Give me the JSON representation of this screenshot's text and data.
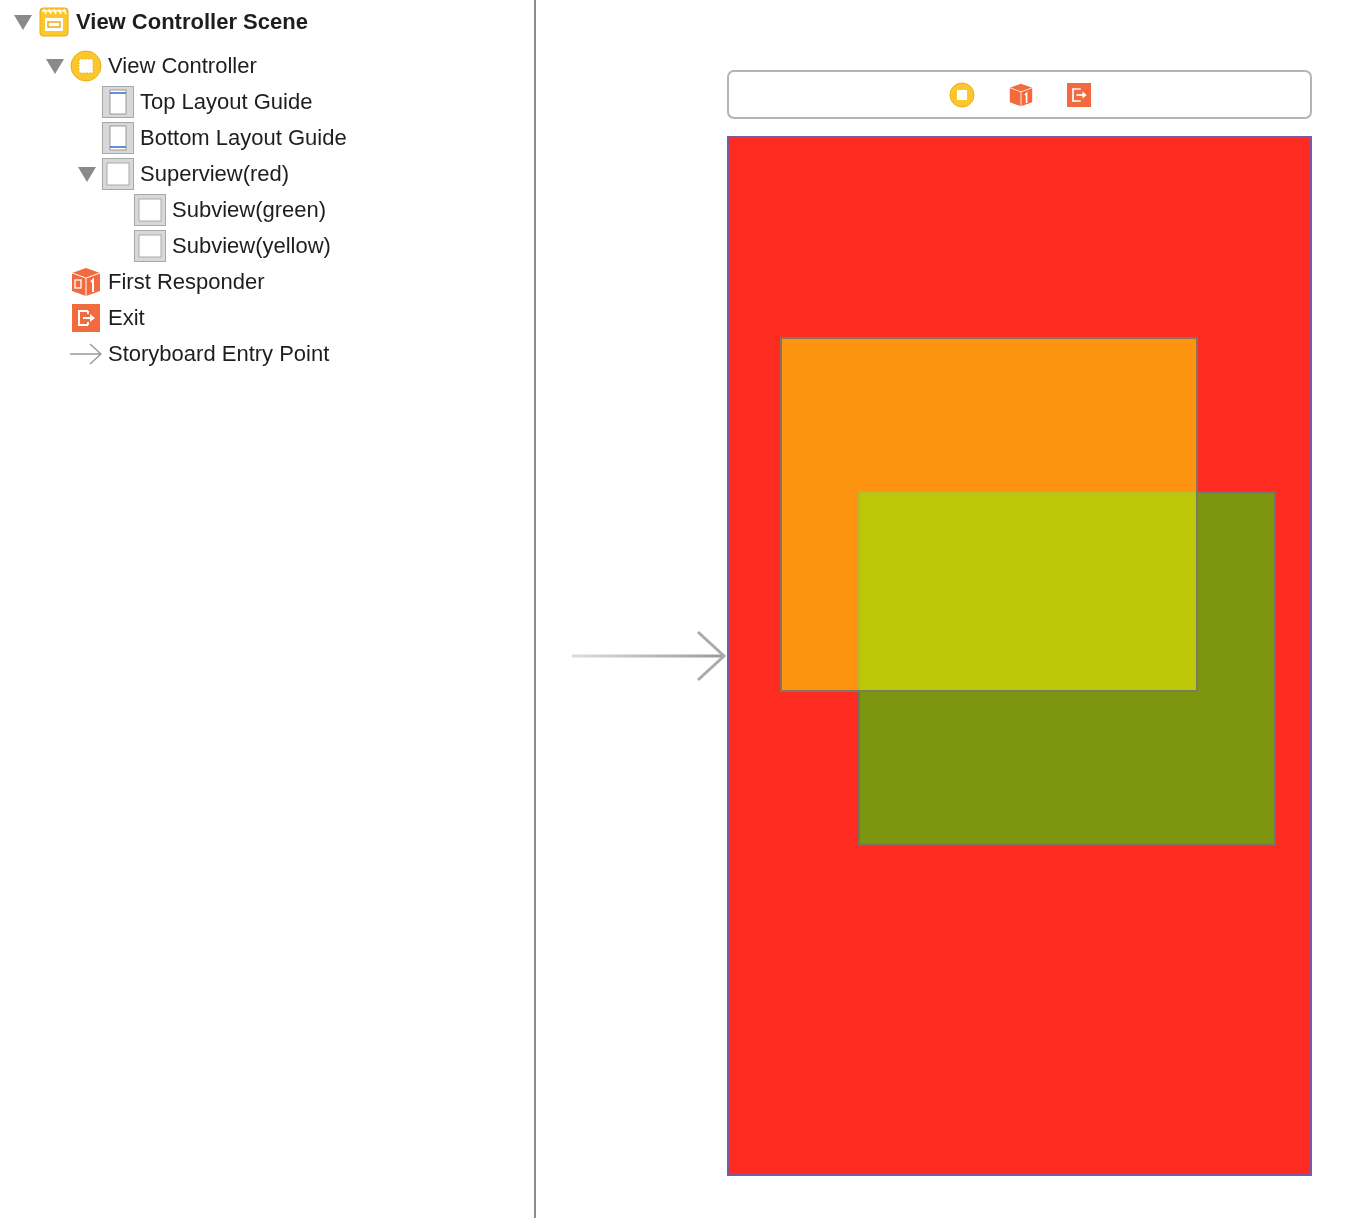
{
  "outline": {
    "items": [
      {
        "kind": "scene",
        "label": "View Controller Scene",
        "expanded": true,
        "children": [
          {
            "kind": "controller",
            "label": "View Controller",
            "expanded": true,
            "children": [
              {
                "kind": "top-guide",
                "label": "Top Layout Guide"
              },
              {
                "kind": "bottom-guide",
                "label": "Bottom Layout Guide"
              },
              {
                "kind": "view",
                "label": "Superview(red)",
                "expanded": true,
                "children": [
                  {
                    "kind": "view",
                    "label": "Subview(green)"
                  },
                  {
                    "kind": "view",
                    "label": "Subview(yellow)"
                  }
                ]
              }
            ]
          },
          {
            "kind": "responder",
            "label": "First Responder"
          },
          {
            "kind": "exit",
            "label": "Exit"
          },
          {
            "kind": "entry",
            "label": "Storyboard Entry Point"
          }
        ]
      }
    ]
  }
}
